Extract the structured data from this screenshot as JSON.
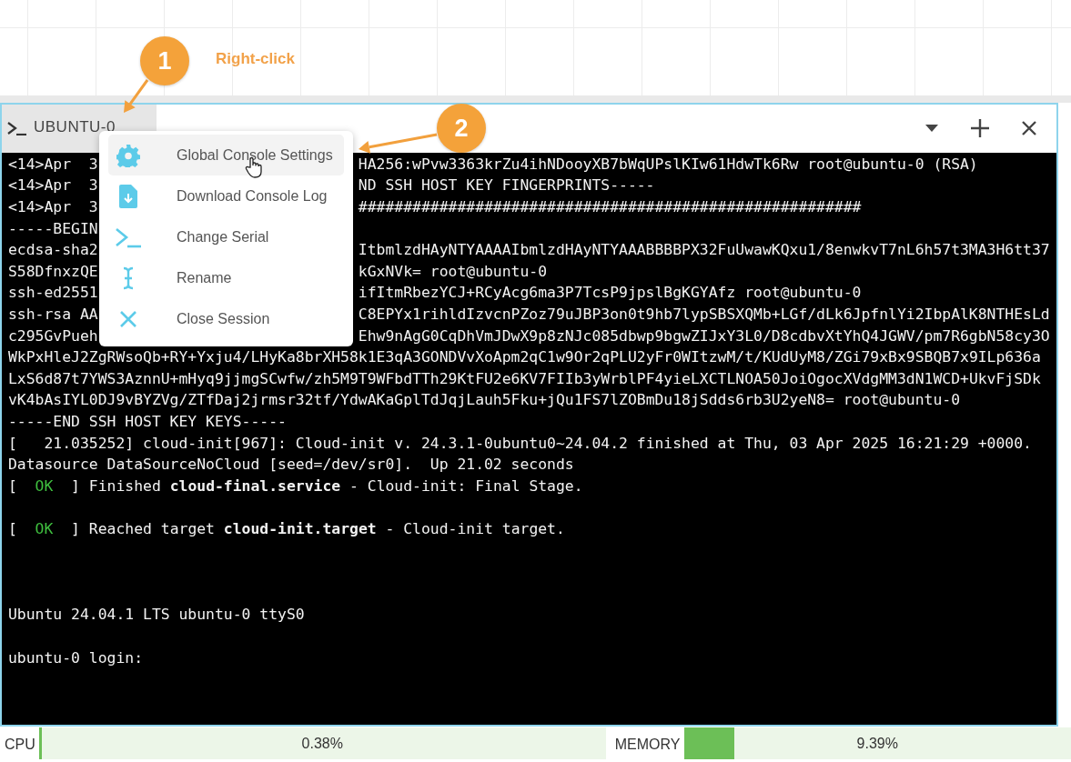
{
  "annotations": [
    {
      "number": "1",
      "note": "Right-click"
    },
    {
      "number": "2"
    }
  ],
  "console": {
    "tab": {
      "label": "UBUNTU-0",
      "selected": true
    },
    "lines": [
      {
        "kind": "split",
        "left": "<14>Apr  3",
        "right": "HA256:wPvw3363krZu4ihNDooyXB7bWqUPslKIw61HdwTk6Rw root@ubuntu-0 (RSA)"
      },
      {
        "kind": "split",
        "left": "<14>Apr  3",
        "right": "ND SSH HOST KEY FINGERPRINTS-----"
      },
      {
        "kind": "split",
        "left": "<14>Apr  3",
        "right": "########################################################"
      },
      {
        "kind": "split",
        "left": "-----BEGIN"
      },
      {
        "kind": "split",
        "left": "ecdsa-sha2",
        "right": "ItbmlzdHAyNTYAAAAIbmlzdHAyNTYAAABBBBPX32FuUwawKQxu1/8enwkvT7nL6h57t3MA3H6tt37"
      },
      {
        "kind": "split",
        "left": "S58DfnxzQE",
        "right": "kGxNVk= root@ubuntu-0"
      },
      {
        "kind": "split",
        "left": "ssh-ed2551",
        "right": "ifItmRbezYCJ+RCyAcg6ma3P7TcsP9jpslBgKGYAfz root@ubuntu-0"
      },
      {
        "kind": "split",
        "left": "ssh-rsa AA",
        "right": "C8EPYx1rihldIzvcnPZoz79uJBP3on0t9hb7lypSBSXQMb+LGf/dLk6JpfnlYi2IbpAlK8NTHEsLd"
      },
      {
        "kind": "split",
        "left": "c295GvPueh",
        "right": "Ehw9nAgG0CqDhVmJDwX9p8zNJc085dbwp9bgwZIJxY3L0/D8cdbvXtYhQ4JGWV/pm7R6gbN58cy3O"
      },
      {
        "kind": "text",
        "text": "WkPxHleJ2ZgRWsoQb+RY+Yxju4/LHyKa8brXH58k1E3qA3GONDVvXoApm2qC1w9Or2qPLU2yFr0WItzwM/t/KUdUyM8/ZGi79xBx9SBQB7x9ILp636a"
      },
      {
        "kind": "text",
        "text": "LxS6d87t7YWS3AznnU+mHyq9jjmgSCwfw/zh5M9T9WFbdTTh29KtFU2e6KV7FIIb3yWrblPF4yieLXCTLNOA50JoiOgocXVdgMM3dN1WCD+UkvFjSDk"
      },
      {
        "kind": "text",
        "text": "vK4bAsIYL0DJ9vBYZVg/ZTfDaj2jrmsr32tf/YdwAKaGplTdJqjLauh5Fku+jQu1FS7lZOBmDu18jSdds6rb3U2yeN8= root@ubuntu-0"
      },
      {
        "kind": "text",
        "text": "-----END SSH HOST KEY KEYS-----"
      },
      {
        "kind": "text",
        "text": "[   21.035252] cloud-init[967]: Cloud-init v. 24.3.1-0ubuntu0~24.04.2 finished at Thu, 03 Apr 2025 16:21:29 +0000."
      },
      {
        "kind": "text",
        "text": "Datasource DataSourceNoCloud [seed=/dev/sr0].  Up 21.02 seconds"
      },
      {
        "kind": "status",
        "prefix": "[  ",
        "status": "OK",
        "suffix": "  ]",
        "text": "Finished **cloud-final.service** - Cloud-init: Final Stage."
      },
      {
        "kind": "blank"
      },
      {
        "kind": "status",
        "prefix": "[  ",
        "status": "OK",
        "suffix": "  ]",
        "text": "Reached target **cloud-init.target** - Cloud-init target."
      },
      {
        "kind": "blank"
      },
      {
        "kind": "blank"
      },
      {
        "kind": "blank"
      },
      {
        "kind": "text",
        "text": "Ubuntu 24.04.1 LTS ubuntu-0 ttyS0"
      },
      {
        "kind": "blank"
      },
      {
        "kind": "text",
        "text": "ubuntu-0 login:"
      }
    ]
  },
  "context_menu": {
    "items": [
      {
        "kind": "settings",
        "label": "Global Console Settings",
        "selected": true
      },
      {
        "kind": "download",
        "label": "Download Console Log",
        "selected": false
      },
      {
        "kind": "serial",
        "label": "Change Serial",
        "selected": false
      },
      {
        "kind": "rename",
        "label": "Rename",
        "selected": false
      },
      {
        "kind": "close",
        "label": "Close Session",
        "selected": false
      }
    ]
  },
  "status_bar": {
    "meters": [
      {
        "label": "CPU",
        "level": 0.005,
        "reading": "0.38%"
      },
      {
        "label": "MEMORY",
        "level": 0.13,
        "reading": "9.39%"
      }
    ]
  }
}
